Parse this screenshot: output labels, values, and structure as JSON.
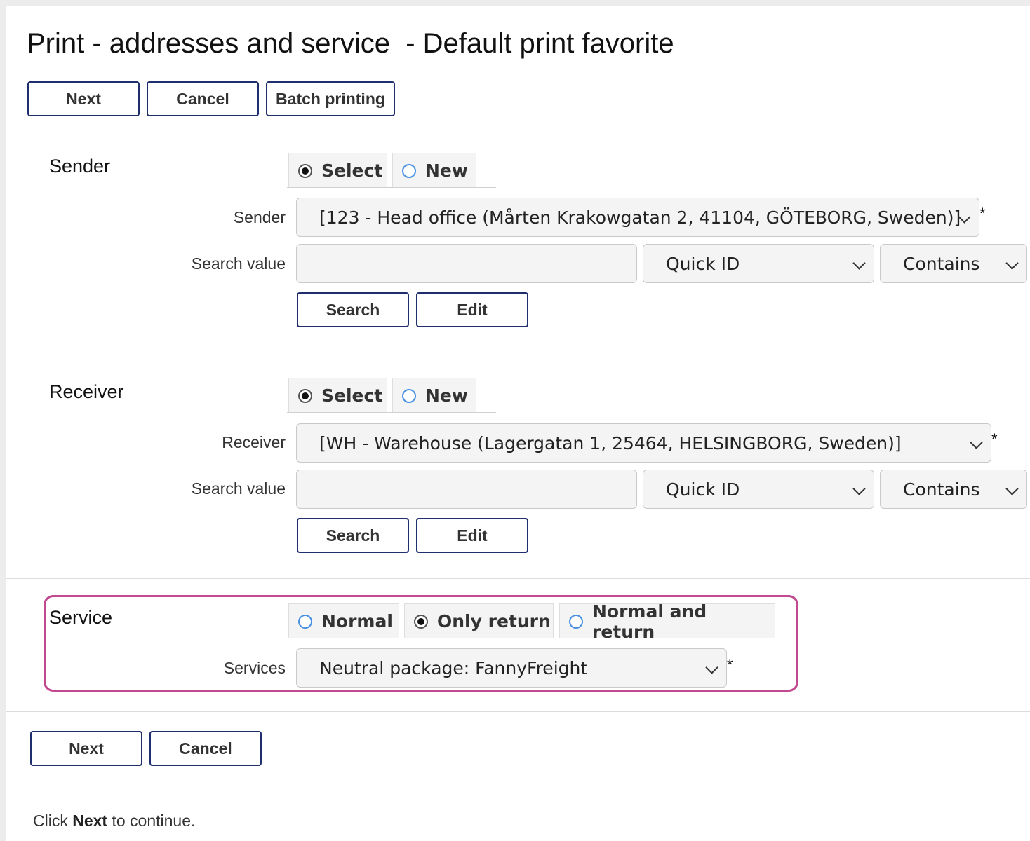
{
  "page": {
    "title": "Print - addresses and service  - Default print favorite"
  },
  "toolbar": {
    "next": "Next",
    "cancel": "Cancel",
    "batch": "Batch printing"
  },
  "sender": {
    "section": "Sender",
    "tabs": [
      {
        "label": "Select",
        "checked": true
      },
      {
        "label": "New",
        "checked": false
      }
    ],
    "field_label": "Sender",
    "value": "[123 - Head office (Mårten Krakowgatan 2, 41104, GÖTEBORG, Sweden)]",
    "required": "*",
    "search_label": "Search value",
    "search_value": "",
    "search_by": "Quick ID",
    "match": "Contains",
    "search_btn": "Search",
    "edit_btn": "Edit"
  },
  "receiver": {
    "section": "Receiver",
    "tabs": [
      {
        "label": "Select",
        "checked": true
      },
      {
        "label": "New",
        "checked": false
      }
    ],
    "field_label": "Receiver",
    "value": "[WH - Warehouse (Lagergatan 1, 25464, HELSINGBORG, Sweden)]",
    "required": "*",
    "search_label": "Search value",
    "search_value": "",
    "search_by": "Quick ID",
    "match": "Contains",
    "search_btn": "Search",
    "edit_btn": "Edit"
  },
  "service": {
    "section": "Service",
    "tabs": [
      {
        "label": "Normal",
        "checked": false
      },
      {
        "label": "Only return",
        "checked": true
      },
      {
        "label": "Normal and return",
        "checked": false
      }
    ],
    "field_label": "Services",
    "value": "Neutral package: FannyFreight",
    "required": "*",
    "highlight_color": "#c2498f"
  },
  "bottom": {
    "next": "Next",
    "cancel": "Cancel"
  },
  "footer": {
    "prefix": "Click ",
    "bold": "Next",
    "suffix": " to continue."
  },
  "colors": {
    "button_border": "#1f2f6e",
    "radio_blue": "#4a90e2",
    "field_bg": "#f4f4f4"
  }
}
